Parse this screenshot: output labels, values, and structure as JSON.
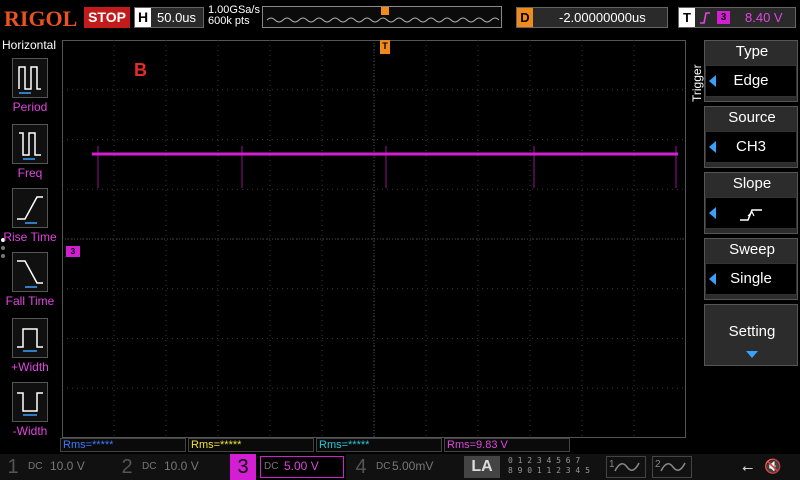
{
  "brand": "RIGOL",
  "run_state": "STOP",
  "horizontal": {
    "label": "H",
    "scale": "50.0us",
    "sample_rate": "1.00GSa/s",
    "memory_depth": "600k pts"
  },
  "delay": {
    "label": "D",
    "value": "-2.00000000us"
  },
  "trigger_status": {
    "label": "T",
    "source_badge": "3",
    "level": "8.40 V"
  },
  "left_menu": {
    "title": "Horizontal",
    "items": [
      {
        "label": "Period",
        "icon": "period-icon"
      },
      {
        "label": "Freq",
        "icon": "frequency-icon"
      },
      {
        "label": "Rise Time",
        "icon": "rise-time-icon"
      },
      {
        "label": "Fall Time",
        "icon": "fall-time-icon"
      },
      {
        "label": "+Width",
        "icon": "positive-width-icon"
      },
      {
        "label": "-Width",
        "icon": "negative-width-icon"
      }
    ]
  },
  "screen": {
    "annotation": "B",
    "trigger_marker": "T",
    "channel_marker": "3"
  },
  "right_menu": {
    "title": "Trigger",
    "items": [
      {
        "title": "Type",
        "value": "Edge"
      },
      {
        "title": "Source",
        "value": "CH3"
      },
      {
        "title": "Slope",
        "value": ""
      },
      {
        "title": "Sweep",
        "value": "Single"
      }
    ],
    "setting": "Setting"
  },
  "measurements": [
    {
      "text": "Rms=*****",
      "color": "#3a7bff"
    },
    {
      "text": "Rms=*****",
      "color": "#f2e23a"
    },
    {
      "text": "Rms=*****",
      "color": "#28c8d8"
    },
    {
      "text": "Rms=9.83 V",
      "color": "#e046e0"
    }
  ],
  "channels": [
    {
      "num": "1",
      "coupling": "DC",
      "scale": "10.0 V",
      "active": false
    },
    {
      "num": "2",
      "coupling": "DC",
      "scale": "10.0 V",
      "active": false
    },
    {
      "num": "3",
      "coupling": "DC",
      "scale": "5.00 V",
      "active": true
    },
    {
      "num": "4",
      "coupling": "DC",
      "scale": "5.00mV",
      "active": false
    }
  ],
  "la_label": "LA",
  "la_digits": [
    "0 1 2 3  4 5 6 7",
    "8 9 0 1  1 2 3 4 5"
  ],
  "generators": [
    {
      "num": "1"
    },
    {
      "num": "2"
    }
  ],
  "colors": {
    "ch3": "#d41ed4",
    "ch1": "#f2e23a",
    "ch2": "#28c8d8",
    "ch4": "#3a7bff",
    "accent": "#3aa0ff",
    "brand": "#e8531f"
  }
}
